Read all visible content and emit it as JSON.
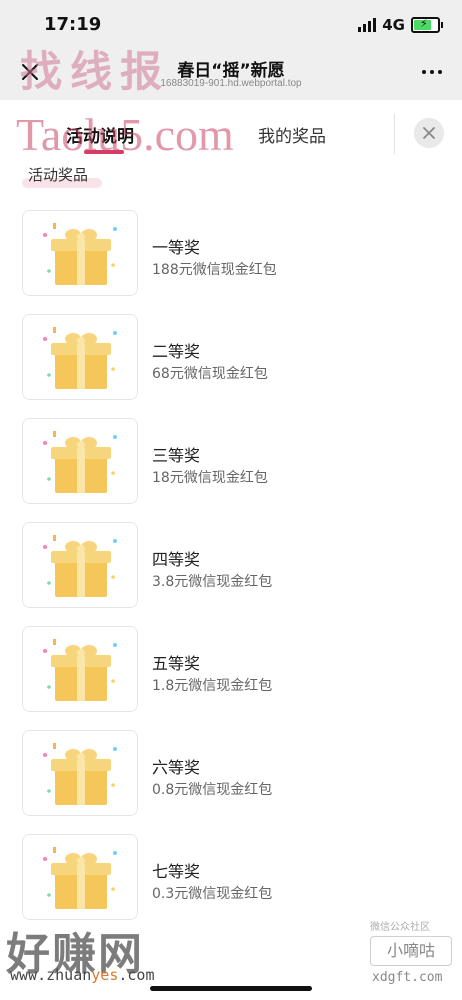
{
  "status_bar": {
    "time": "17:19",
    "network": "4G",
    "battery_icon": "battery-charging-icon"
  },
  "nav": {
    "title": "春日“摇”新愿",
    "url": "16883019-901.hd.webportal.top"
  },
  "watermarks": {
    "top_cn": "找线报",
    "taolu": "Taolu5.com",
    "bottom_cn": "好赚网",
    "bottom_site_prefix": "www.zhuan",
    "bottom_site_highlight": "yes",
    "bottom_site_suffix": ".com",
    "community": "微信公众社区",
    "xiaodigu": "小嘀咕",
    "xdgft": "xdgft.com"
  },
  "tabs": [
    {
      "label": "活动说明"
    },
    {
      "label": "我的奖品"
    }
  ],
  "section_label": "活动奖品",
  "prizes": [
    {
      "name": "一等奖",
      "desc": "188元微信现金红包"
    },
    {
      "name": "二等奖",
      "desc": "68元微信现金红包"
    },
    {
      "name": "三等奖",
      "desc": "18元微信现金红包"
    },
    {
      "name": "四等奖",
      "desc": "3.8元微信现金红包"
    },
    {
      "name": "五等奖",
      "desc": "1.8元微信现金红包"
    },
    {
      "name": "六等奖",
      "desc": "0.8元微信现金红包"
    },
    {
      "name": "七等奖",
      "desc": "0.3元微信现金红包"
    }
  ],
  "colors": {
    "accent": "#d63a66",
    "gift_box": "#f5c75a",
    "gift_ribbon": "#f9e6a8",
    "nav_bg": "#efefef"
  }
}
